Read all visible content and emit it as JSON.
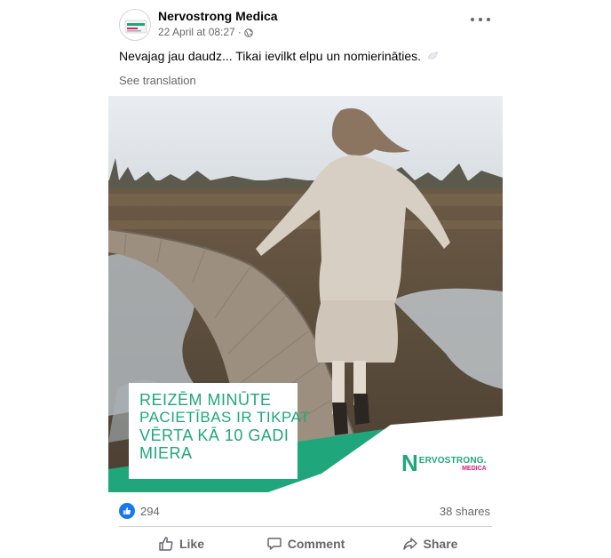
{
  "post": {
    "page_name": "Nervostrong Medica",
    "date": "22 April at 08:27",
    "separator": "·",
    "text": "Nevajag jau daudz... Tikai ievilkt elpu un nomierināties.",
    "see_translation": "See translation"
  },
  "image": {
    "headline_lines": [
      "REIZĒM MINŪTE",
      "PACIETĪBAS IR TIKPAT",
      "VĒRTA KĀ 10 GADI",
      "MIERA"
    ],
    "brand": {
      "letter": "N",
      "name": "ERVOSTRONG.",
      "sub": "MEDICA"
    },
    "colors": {
      "green": "#1fa77b",
      "pink": "#e0197a"
    }
  },
  "engagement": {
    "reaction_count": "294",
    "shares": "38 shares"
  },
  "actions": {
    "like": "Like",
    "comment": "Comment",
    "share": "Share"
  },
  "icons": [
    "more-icon",
    "globe-icon",
    "dove-icon",
    "like-reaction-icon",
    "thumbs-up-icon",
    "comment-icon",
    "share-icon"
  ]
}
